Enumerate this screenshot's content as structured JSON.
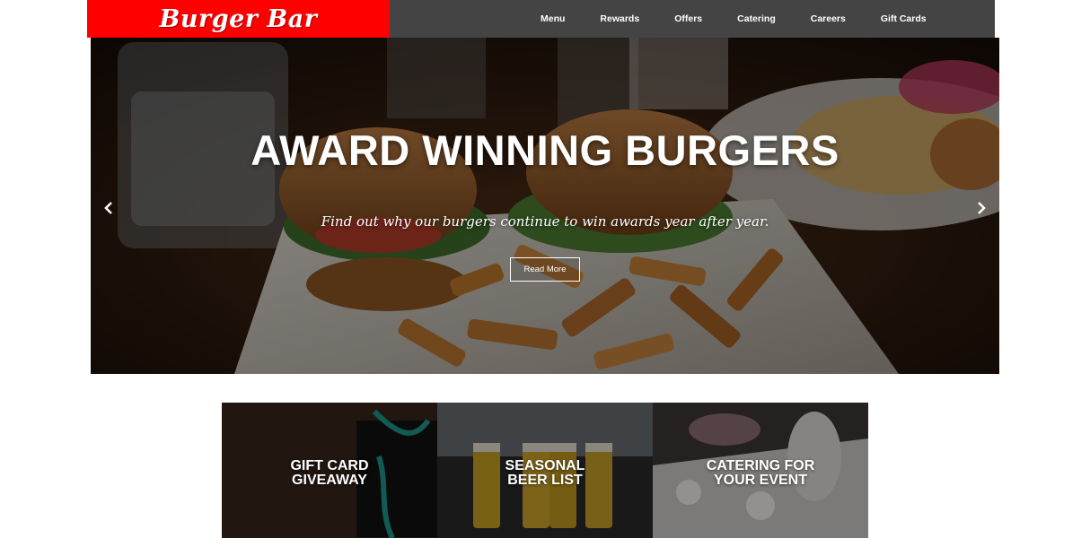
{
  "header": {
    "logo": "Burger Bar",
    "nav": [
      "Menu",
      "Rewards",
      "Offers",
      "Catering",
      "Careers",
      "Gift Cards"
    ],
    "colors": {
      "logo_bg": "#ff0000",
      "nav_bg": "#444444"
    }
  },
  "hero": {
    "title": "AWARD WINNING BURGERS",
    "subtitle": "Find out why our burgers continue to win awards year after year.",
    "button": "Read More",
    "prev_icon": "chevron-left-icon",
    "next_icon": "chevron-right-icon"
  },
  "tiles": [
    {
      "line1": "GIFT CARD",
      "line2": "GIVEAWAY"
    },
    {
      "line1": "SEASONAL",
      "line2": "BEER LIST"
    },
    {
      "line1": "CATERING FOR",
      "line2": "YOUR EVENT"
    }
  ]
}
